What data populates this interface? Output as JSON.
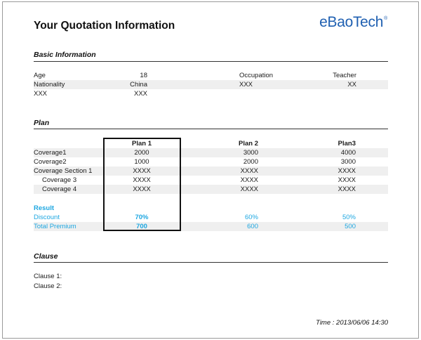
{
  "document": {
    "title": "Your Quotation Information",
    "logo_text": "eBaoTech",
    "logo_mark": "®",
    "brand_color": "#1e5fb1",
    "accent_color": "#1ea7e1"
  },
  "basic": {
    "heading": "Basic Information",
    "rows": [
      {
        "label": "Age",
        "value": "18",
        "label2": "Occupation",
        "value2": "Teacher"
      },
      {
        "label": "Nationality",
        "value": "China",
        "label2": "XXX",
        "value2": "XX"
      },
      {
        "label": "XXX",
        "value": "XXX",
        "label2": "",
        "value2": ""
      }
    ]
  },
  "plan": {
    "heading": "Plan",
    "columns": [
      "Plan 1",
      "Plan 2",
      "Plan3"
    ],
    "rows": [
      {
        "label": "Coverage1",
        "values": [
          "2000",
          "3000",
          "4000"
        ]
      },
      {
        "label": "Coverage2",
        "values": [
          "1000",
          "2000",
          "3000"
        ]
      },
      {
        "label": "Coverage Section 1",
        "values": [
          "XXXX",
          "XXXX",
          "XXXX"
        ]
      },
      {
        "label": "Coverage 3",
        "values": [
          "XXXX",
          "XXXX",
          "XXXX"
        ]
      },
      {
        "label": "Coverage 4",
        "values": [
          "XXXX",
          "XXXX",
          "XXXX"
        ]
      }
    ],
    "result_label": "Result",
    "results": [
      {
        "label": "Discount",
        "values": [
          "70%",
          "60%",
          "50%"
        ]
      },
      {
        "label": "Total Premium",
        "values": [
          "700",
          "600",
          "500"
        ]
      }
    ]
  },
  "clause": {
    "heading": "Clause",
    "items": [
      "Clause 1:",
      "Clause 2:"
    ]
  },
  "footer": {
    "time": "Time : 2013/06/06  14:30"
  }
}
